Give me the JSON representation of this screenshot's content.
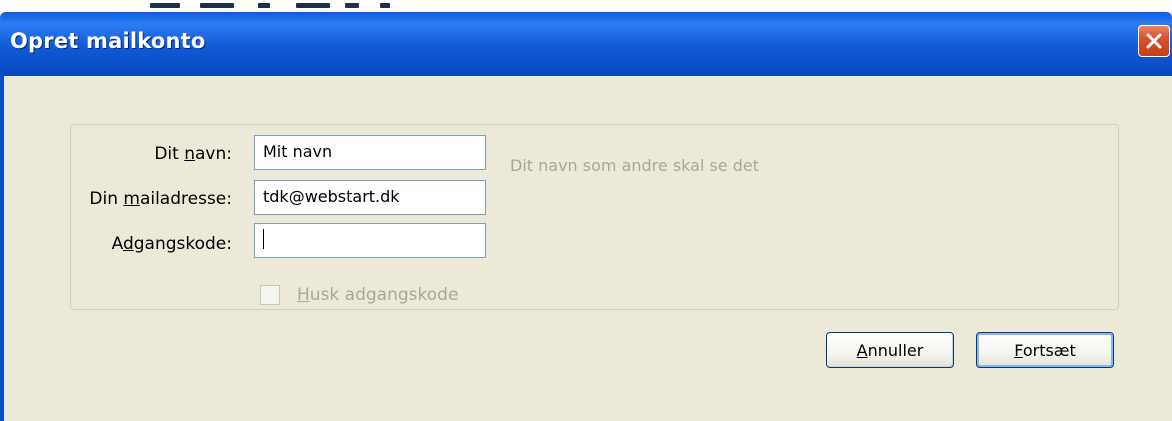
{
  "window": {
    "title": "Opret mailkonto",
    "close_icon": "close-icon"
  },
  "form": {
    "name_label_pre": "Dit ",
    "name_label_acc": "n",
    "name_label_post": "avn:",
    "name_value": "Mit navn",
    "name_hint": "Dit navn som andre skal se det",
    "email_label_pre": "Din ",
    "email_label_acc": "m",
    "email_label_post": "ailadresse:",
    "email_value": "tdk@webstart.dk",
    "password_label_pre": "A",
    "password_label_acc": "d",
    "password_label_post": "gangskode:",
    "password_value": "",
    "remember_label_acc": "H",
    "remember_label_post": "usk adgangskode",
    "remember_checked": false,
    "remember_enabled": false
  },
  "buttons": {
    "cancel_acc": "A",
    "cancel_post": "nnuller",
    "continue_acc": "F",
    "continue_post": "ortsæt"
  },
  "colors": {
    "titlebar": "#0b4fc8",
    "window_bg": "#ece9d8",
    "close_button": "#d8522c",
    "disabled_text": "#a8a89a"
  }
}
